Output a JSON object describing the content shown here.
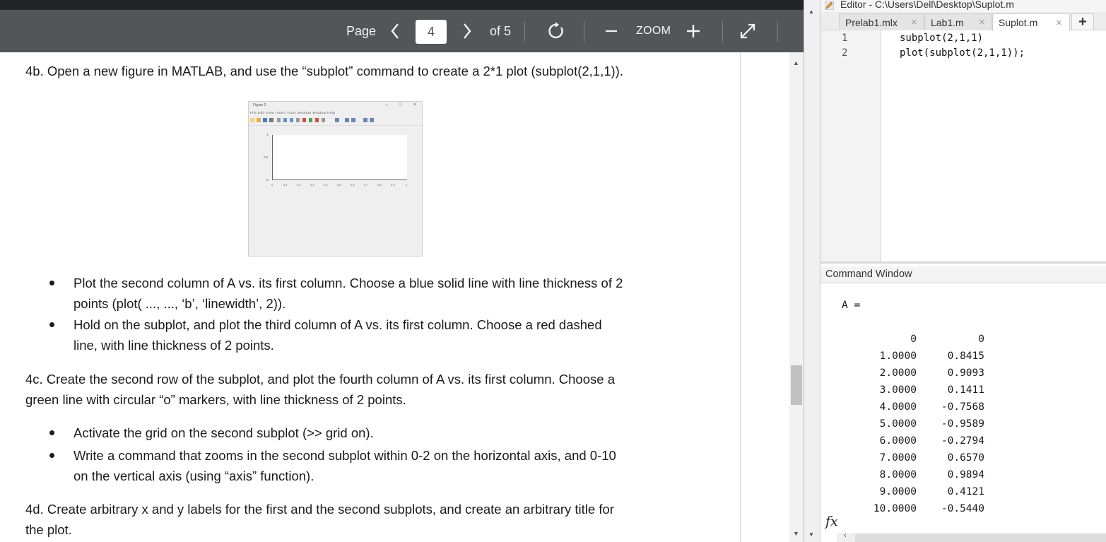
{
  "pdf_viewer": {
    "page_label": "Page",
    "current_page": "4",
    "of_pages": "of 5",
    "zoom_label": "ZOOM",
    "document": {
      "section_4b": "4b. Open a new figure in MATLAB, and use the “subplot” command to create a 2*1 plot (subplot(2,1,1)).",
      "figure_thumbnail": {
        "title": "Figure 2",
        "menu": "File  Edit  View  Insert  Tools  Desktop  Window  Help",
        "y_ticks": [
          "1",
          "0.5",
          "0"
        ],
        "x_ticks": [
          "0",
          "0.1",
          "0.2",
          "0.3",
          "0.4",
          "0.5",
          "0.6",
          "0.7",
          "0.8",
          "0.9",
          "1"
        ]
      },
      "bullets_4b": [
        [
          "Plot the second column of A vs. its first column. Choose a blue solid line with line thickness of 2",
          "points (plot( ..., ..., ‘b’, ‘linewidth’, 2))."
        ],
        [
          "Hold on the subplot, and plot the third column of A vs. its first column. Choose a red dashed",
          "line, with line thickness of 2 points."
        ]
      ],
      "section_4c": [
        "4c. Create the second row of the subplot, and plot the fourth column of A vs. its first column. Choose a",
        "green line with circular “o” markers, with line thickness of 2 points."
      ],
      "bullets_4c": [
        [
          "Activate the grid on the second subplot  (>> grid on)."
        ],
        [
          "Write a command that zooms in the second subplot within 0-2 on the horizontal axis, and 0-10",
          "on the vertical axis (using “axis” function)."
        ]
      ],
      "section_4d": [
        "4d. Create arbitrary x and y labels for the first and the second subplots, and create an arbitrary title for",
        "the plot."
      ]
    }
  },
  "editor": {
    "title": "Editor - C:\\Users\\Dell\\Desktop\\Suplot.m",
    "tabs": [
      {
        "label": "Prelab1.mlx",
        "active": false
      },
      {
        "label": "Lab1.m",
        "active": false
      },
      {
        "label": "Suplot.m",
        "active": true
      }
    ],
    "add_tab": "+",
    "lines": [
      {
        "num": "1",
        "code": "subplot(2,1,1)"
      },
      {
        "num": "2",
        "code": "plot(subplot(2,1,1));"
      }
    ]
  },
  "command_window": {
    "title": "Command Window",
    "var_label": "A =",
    "matrix": [
      [
        "0",
        "0"
      ],
      [
        "1.0000",
        "0.8415"
      ],
      [
        "2.0000",
        "0.9093"
      ],
      [
        "3.0000",
        "0.1411"
      ],
      [
        "4.0000",
        "-0.7568"
      ],
      [
        "5.0000",
        "-0.9589"
      ],
      [
        "6.0000",
        "-0.2794"
      ],
      [
        "7.0000",
        "0.6570"
      ],
      [
        "8.0000",
        "0.9894"
      ],
      [
        "9.0000",
        "0.4121"
      ],
      [
        "10.0000",
        "-0.5440"
      ]
    ],
    "prompt_icon": "fx"
  },
  "icons": {
    "prev": "chevron-left-icon",
    "next": "chevron-right-icon",
    "rotate": "rotate-icon",
    "zoom_out": "minus-icon",
    "zoom_in": "plus-icon",
    "fullscreen": "expand-icon"
  }
}
